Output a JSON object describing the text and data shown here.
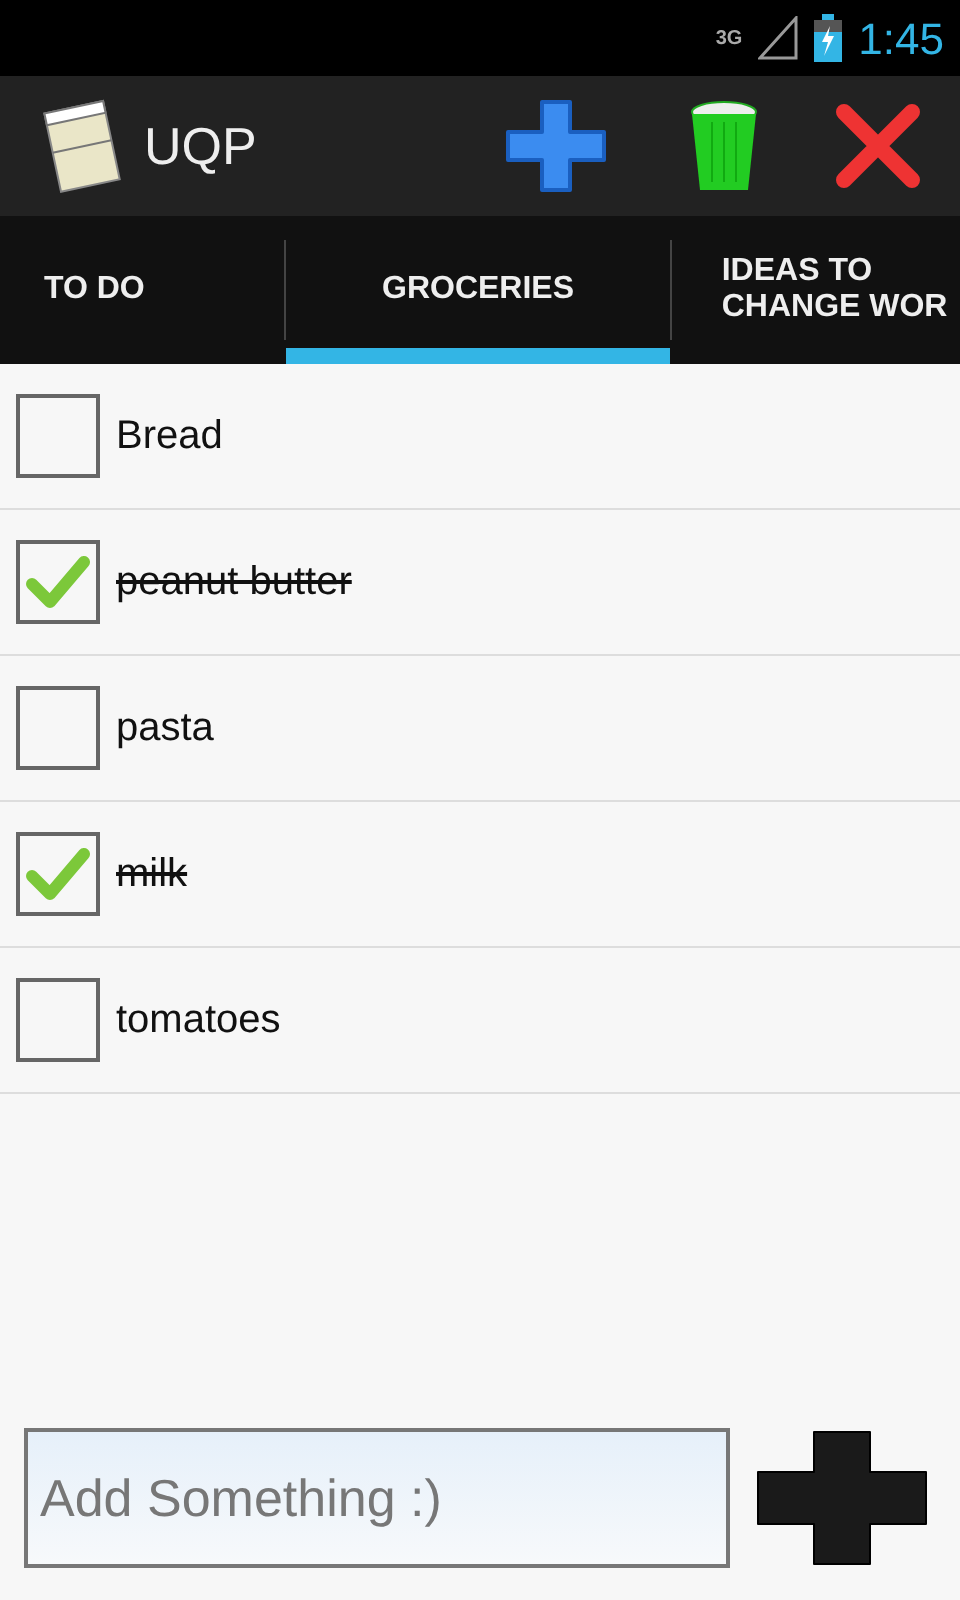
{
  "status_bar": {
    "network": "3G",
    "time": "1:45"
  },
  "app_bar": {
    "title": "UQP"
  },
  "tabs": [
    {
      "label": "TO DO",
      "selected": false
    },
    {
      "label": "GROCERIES",
      "selected": true
    },
    {
      "label": "IDEAS TO CHANGE WOR",
      "selected": false
    }
  ],
  "items": [
    {
      "text": "Bread",
      "checked": false
    },
    {
      "text": "peanut butter",
      "checked": true
    },
    {
      "text": "pasta",
      "checked": false
    },
    {
      "text": "milk",
      "checked": true
    },
    {
      "text": "tomatoes",
      "checked": false
    }
  ],
  "new_item": {
    "placeholder": "Add Something :)"
  }
}
